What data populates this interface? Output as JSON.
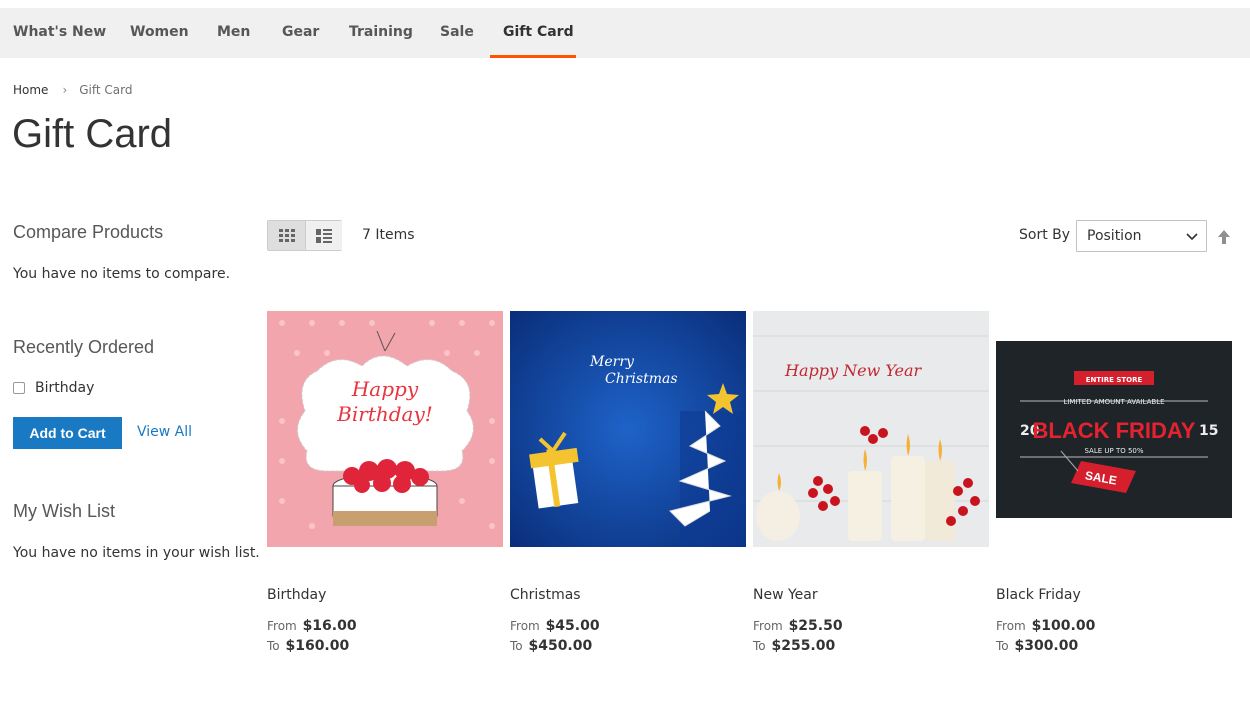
{
  "nav": {
    "items": [
      {
        "label": "What's New"
      },
      {
        "label": "Women"
      },
      {
        "label": "Men"
      },
      {
        "label": "Gear"
      },
      {
        "label": "Training"
      },
      {
        "label": "Sale"
      },
      {
        "label": "Gift Card"
      }
    ],
    "active_index": 6
  },
  "breadcrumb": {
    "home": "Home",
    "current": "Gift Card"
  },
  "page_title": "Gift Card",
  "sidebar": {
    "compare": {
      "title": "Compare Products",
      "empty": "You have no items to compare."
    },
    "recently_ordered": {
      "title": "Recently Ordered",
      "items": [
        {
          "label": "Birthday",
          "checked": false
        }
      ],
      "add_to_cart": "Add to Cart",
      "view_all": "View All"
    },
    "wishlist": {
      "title": "My Wish List",
      "empty": "You have no items in your wish list."
    }
  },
  "toolbar": {
    "amount": "7 Items",
    "sort_label": "Sort By",
    "sort_value": "Position"
  },
  "products": [
    {
      "name": "Birthday",
      "from_label": "From",
      "from_price": "$16.00",
      "to_label": "To",
      "to_price": "$160.00",
      "image_text": [
        "Happy",
        "Birthday!"
      ]
    },
    {
      "name": "Christmas",
      "from_label": "From",
      "from_price": "$45.00",
      "to_label": "To",
      "to_price": "$450.00",
      "image_text": [
        "Merry",
        "Christmas"
      ]
    },
    {
      "name": "New Year",
      "from_label": "From",
      "from_price": "$25.50",
      "to_label": "To",
      "to_price": "$255.00",
      "image_text": [
        "Happy New Year"
      ]
    },
    {
      "name": "Black Friday",
      "from_label": "From",
      "from_price": "$100.00",
      "to_label": "To",
      "to_price": "$300.00",
      "image_text": [
        "ENTIRE STORE",
        "LIMITED AMOUNT AVAILABLE",
        "20",
        "BLACK FRIDAY",
        "15",
        "SALE UP TO 50%",
        "SALE"
      ]
    }
  ],
  "colors": {
    "accent": "#ff5501",
    "link": "#1979c3",
    "button": "#1979c3",
    "nav_bg": "#f0f0f0"
  }
}
